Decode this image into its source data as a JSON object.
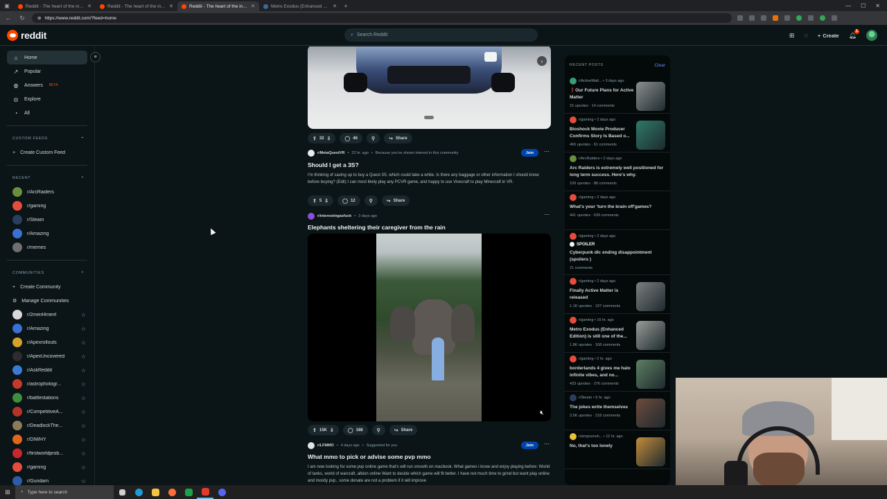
{
  "browser": {
    "tabs": [
      {
        "title": "Reddit - The heart of the internet",
        "active": false
      },
      {
        "title": "Reddit - The heart of the internet",
        "active": false
      },
      {
        "title": "Reddit - The heart of the internet",
        "active": true
      },
      {
        "title": "Metro Exodus (Enhanced Edition)",
        "active": false
      }
    ],
    "url": "https://www.reddit.com/?feed=home"
  },
  "header": {
    "logo": "reddit",
    "search_placeholder": "Search Reddit",
    "create_label": "Create",
    "notification_count": "1"
  },
  "sidebar": {
    "nav": [
      {
        "label": "Home",
        "icon": "home-icon",
        "active": true
      },
      {
        "label": "Popular",
        "icon": "popular-icon"
      },
      {
        "label": "Answers",
        "icon": "answers-icon",
        "badge": "BETA"
      },
      {
        "label": "Explore",
        "icon": "explore-icon"
      },
      {
        "label": "All",
        "icon": "all-icon"
      }
    ],
    "custom_feeds_title": "CUSTOM FEEDS",
    "create_custom_feed": "Create Custom Feed",
    "recent_title": "RECENT",
    "recent": [
      {
        "name": "r/ArcRaiders",
        "color": "#6a8f3c"
      },
      {
        "name": "r/gaming",
        "color": "#e54c3c"
      },
      {
        "name": "r/Steam",
        "color": "#2a3f5f"
      },
      {
        "name": "r/Amazing",
        "color": "#3b6fd1"
      },
      {
        "name": "r/memes",
        "color": "#6f6f6f"
      }
    ],
    "communities_title": "COMMUNITIES",
    "create_community": "Create Community",
    "manage_communities": "Manage Communities",
    "communities": [
      {
        "name": "r/2meirl4meirl",
        "color": "#d8d8d8"
      },
      {
        "name": "r/Amazing",
        "color": "#3b6fd1"
      },
      {
        "name": "r/Apexrollouts",
        "color": "#d4a22a"
      },
      {
        "name": "r/ApexUncovered",
        "color": "#2d2d2d"
      },
      {
        "name": "r/AskReddit",
        "color": "#3a7ad6"
      },
      {
        "name": "r/astrophotogr...",
        "color": "#c33a2b"
      },
      {
        "name": "r/battlestations",
        "color": "#3f8d3f"
      },
      {
        "name": "r/CompetitiveA...",
        "color": "#b5342a"
      },
      {
        "name": "r/DeadlockThe...",
        "color": "#8c7a5a"
      },
      {
        "name": "r/DIWHY",
        "color": "#e0661e"
      },
      {
        "name": "r/firstworldprob...",
        "color": "#c9272c"
      },
      {
        "name": "r/gaming",
        "color": "#e54c3c"
      },
      {
        "name": "r/Gundam",
        "color": "#2e5aa8"
      }
    ]
  },
  "feed": {
    "post1_actions": {
      "votes": "32",
      "comments": "46",
      "share": "Share"
    },
    "post2": {
      "subreddit": "r/MetaQuestVR",
      "time": "22 hr. ago",
      "reason": "Because you've shown interest in this community",
      "join": "Join",
      "title": "Should I get a 3S?",
      "body": "I'm thinking of saving up to buy a Quest 3S, which could take a while. Is there any baggage or other information I should know before buying? (Edit) I can most likely play any PCVR game, and happy to use Vivecraft to play Minecraft in VR.",
      "votes": "5",
      "comments": "12",
      "share": "Share"
    },
    "post3": {
      "subreddit": "r/interestingasfuck",
      "time": "3 days ago",
      "title": "Elephants sheltering their caregiver from the rain",
      "votes": "15K",
      "comments": "168",
      "share": "Share"
    },
    "post4": {
      "subreddit": "r/LFMMO",
      "time": "4 days ago",
      "reason": "Suggested for you",
      "join": "Join",
      "title": "What mmo to pick or advise some pvp mmo",
      "body": "I am now looking for some pvp online game that's will run smooth on macbook. What games i know and enjoy playing before: World of tanks, world of warcraft, albion online Want to decide which game will fit better. I have not much time to grind but want play online and mostly pvp.. some donate are not a problem if it will improve"
    }
  },
  "recent_posts": {
    "title": "RECENT POSTS",
    "clear": "Clear",
    "items": [
      {
        "sub": "r/ActiveMatt...",
        "time": "3 days ago",
        "title": "❗Our Future Plans for Active Matter",
        "upvotes": "15 upvotes",
        "comments": "14 comments",
        "thumb": "#8a8f90",
        "av": "#3a9b7a"
      },
      {
        "sub": "r/gaming",
        "time": "2 days ago",
        "title": "Bioshock Movie Producer Confirms Story Is Based o...",
        "upvotes": "466 upvotes",
        "comments": "61 comments",
        "thumb": "#2e7a6a",
        "av": "#e54c3c"
      },
      {
        "sub": "r/ArcRaiders",
        "time": "2 days ago",
        "title": "Arc Raiders is extremely well positioned for long term success. Here's why.",
        "upvotes": "109 upvotes",
        "comments": "88 comments",
        "av": "#6a8f3c"
      },
      {
        "sub": "r/gaming",
        "time": "2 days ago",
        "title": "What's your 'turn the brain off'games?",
        "upvotes": "441 upvotes",
        "comments": "639 comments",
        "av": "#e54c3c"
      },
      {
        "sub": "r/gaming",
        "time": "2 days ago",
        "title": "Cyberpunk dlc ending disappointment (spoilers )",
        "spoiler": "SPOILER",
        "upvotes": "",
        "comments": "21 comments",
        "av": "#e54c3c"
      },
      {
        "sub": "r/gaming",
        "time": "2 days ago",
        "title": "Finally Active Matter is released",
        "upvotes": "1.1K upvotes",
        "comments": "197 comments",
        "thumb": "#7c7f80",
        "av": "#e54c3c"
      },
      {
        "sub": "r/gaming",
        "time": "16 hr. ago",
        "title": "Metro Exodus (Enhanced Edition) is still one of the...",
        "upvotes": "1.8K upvotes",
        "comments": "168 comments",
        "thumb": "#9a9c98",
        "av": "#e54c3c"
      },
      {
        "sub": "r/gaming",
        "time": "2 hr. ago",
        "title": "borderlands 4 gives me halo infinite vibes, and no...",
        "upvotes": "433 upvotes",
        "comments": "276 comments",
        "thumb": "#5e7f63",
        "av": "#e54c3c"
      },
      {
        "sub": "r/Steam",
        "time": "5 hr. ago",
        "title": "The jokes write themselves",
        "upvotes": "3.5K upvotes",
        "comments": "218 comments",
        "thumb": "#6e4b3c",
        "av": "#2a3f5f"
      },
      {
        "sub": "r/simpsonsh...",
        "time": "12 hr. ago",
        "title": "No, that's too lonely",
        "upvotes": "",
        "comments": "",
        "thumb": "#c48b3a",
        "av": "#e6c23a"
      }
    ]
  },
  "taskbar": {
    "search_placeholder": "Type here to search"
  },
  "colors": {
    "background": "#0b1416",
    "accent": "#ff4500",
    "join": "#0045ac"
  }
}
